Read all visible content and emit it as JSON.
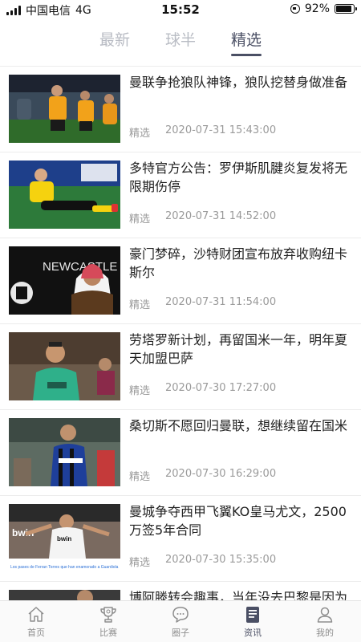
{
  "status_bar": {
    "carrier": "中国电信",
    "network": "4G",
    "time": "15:52",
    "battery": "92%",
    "battery_level": 0.92
  },
  "tabs": [
    {
      "label": "最新",
      "active": false
    },
    {
      "label": "球半",
      "active": false
    },
    {
      "label": "精选",
      "active": true
    }
  ],
  "articles": [
    {
      "title": "曼联争抢狼队神锋，狼队挖替身做准备",
      "tag": "精选",
      "time": "2020-07-31 15:43:00"
    },
    {
      "title": "多特官方公告：罗伊斯肌腱炎复发将无限期伤停",
      "tag": "精选",
      "time": "2020-07-31 14:52:00"
    },
    {
      "title": "豪门梦碎，沙特财团宣布放弃收购纽卡斯尔",
      "tag": "精选",
      "time": "2020-07-31 11:54:00"
    },
    {
      "title": "劳塔罗新计划，再留国米一年，明年夏天加盟巴萨",
      "tag": "精选",
      "time": "2020-07-30 17:27:00"
    },
    {
      "title": "桑切斯不愿回归曼联，想继续留在国米",
      "tag": "精选",
      "time": "2020-07-30 16:29:00"
    },
    {
      "title": "曼城争夺西甲飞翼KO皇马尤文，2500万签5年合同",
      "tag": "精选",
      "time": "2020-07-30 15:35:00"
    },
    {
      "title": "博阿滕转会趣事，当年没去巴黎是因为",
      "tag": "",
      "time": ""
    }
  ],
  "thumb_texts": {
    "newcastle_board": "NEWCASTLE UNITED",
    "bwin": "bwin",
    "caption": "Los pases de Ferran Torres que han enamorado a Guardiola"
  },
  "bottom_nav": [
    {
      "label": "首页",
      "icon": "home-icon",
      "active": false
    },
    {
      "label": "比赛",
      "icon": "trophy-icon",
      "active": false
    },
    {
      "label": "圈子",
      "icon": "chat-bubble-icon",
      "active": false
    },
    {
      "label": "资讯",
      "icon": "news-icon",
      "active": true
    },
    {
      "label": "我的",
      "icon": "person-icon",
      "active": false
    }
  ],
  "colors": {
    "accent": "#4a4f64",
    "inactive_tab": "#b9bcc4",
    "meta_text": "#9a9a9a"
  }
}
